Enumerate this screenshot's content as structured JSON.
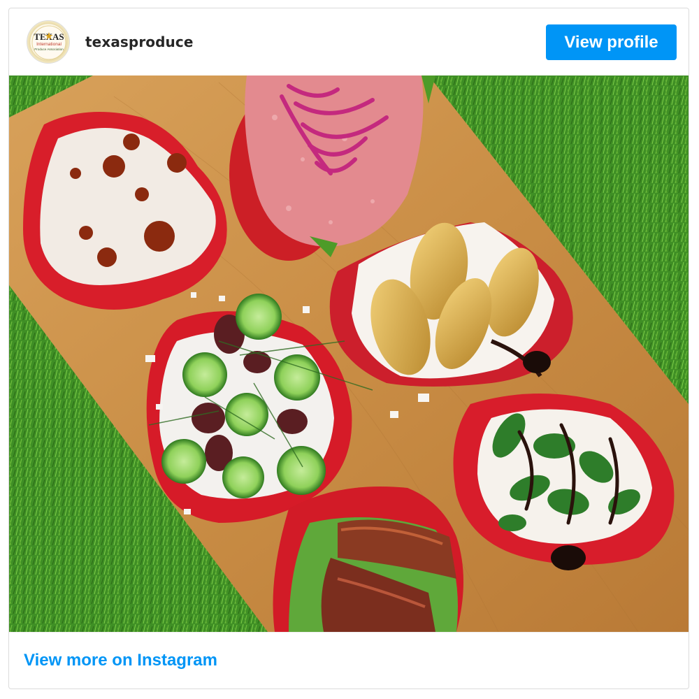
{
  "header": {
    "username": "texasproduce",
    "view_profile_label": "View profile",
    "avatar_icon": "texas-international-produce-association-logo"
  },
  "photo": {
    "icon": "food-board-photo"
  },
  "footer": {
    "view_more_label": "View more on Instagram"
  },
  "colors": {
    "accent": "#0095f6",
    "username_text": "#262626",
    "border": "#dbdbdb"
  }
}
